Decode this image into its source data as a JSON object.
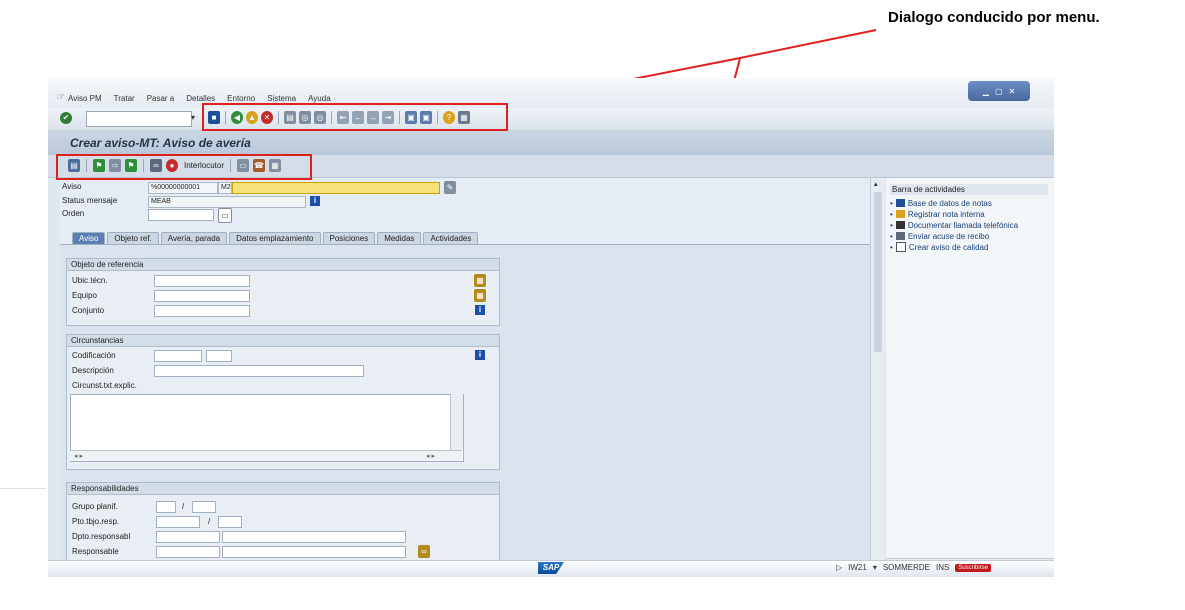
{
  "annotation": {
    "text": "Dialogo conducido por menu."
  },
  "menu": {
    "items": [
      "Aviso PM",
      "Tratar",
      "Pasar a",
      "Detalles",
      "Entorno",
      "Sistema",
      "Ayuda"
    ]
  },
  "header": {
    "title": "Crear aviso-MT: Aviso de avería"
  },
  "toolbar2": {
    "interlocutor_label": "Interlocutor"
  },
  "fields": {
    "aviso_label": "Aviso",
    "aviso_value": "%00000000001",
    "aviso_type": "M2",
    "status_label": "Status mensaje",
    "status_value": "MEAB",
    "orden_label": "Orden"
  },
  "tabs": [
    "Aviso",
    "Objeto ref.",
    "Avería, parada",
    "Datos emplazamiento",
    "Posiciones",
    "Medidas",
    "Actividades"
  ],
  "groups": {
    "objeto": {
      "title": "Objeto de referencia",
      "labels": [
        "Ubic.técn.",
        "Equipo",
        "Conjunto"
      ]
    },
    "circunstancias": {
      "title": "Circunstancias",
      "codificacion": "Codificación",
      "descripcion": "Descripción",
      "txt_explic": "Circunst.txt.explic."
    },
    "responsabilidades": {
      "title": "Responsabilidades",
      "labels": [
        "Grupo planif.",
        "Pto.tbjo.resp.",
        "Dpto.responsabl",
        "Responsable"
      ]
    }
  },
  "right_panel": {
    "title": "Barra de actividades",
    "items": [
      "Base de datos de notas",
      "Registrar nota interna",
      "Documentar llamada telefónica",
      "Enviar acuse de recibo",
      "Crear aviso de calidad"
    ]
  },
  "status_bar": {
    "logo": "SAP",
    "transaction": "IW21",
    "system": "SOMMERDE",
    "mode": "INS",
    "subscribe": "Suscribirse"
  }
}
